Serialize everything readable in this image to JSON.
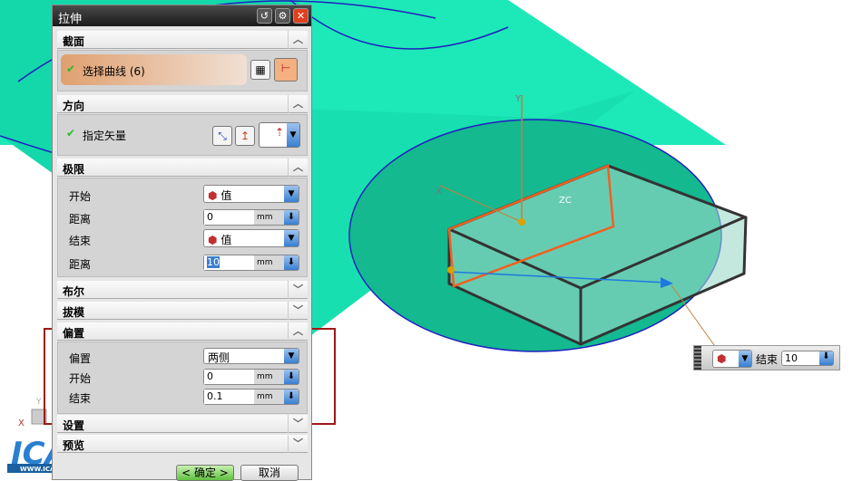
{
  "dialog": {
    "title": "拉伸",
    "title_buttons": [
      "reset",
      "settings",
      "close"
    ]
  },
  "sections": {
    "section": {
      "header": "截面",
      "select_curve": "选择曲线 (6)"
    },
    "direction": {
      "header": "方向",
      "specify_vector": "指定矢量"
    },
    "limits": {
      "header": "极限",
      "start_label": "开始",
      "start_option": "值",
      "distance1_label": "距离",
      "distance1_value": "0",
      "end_label": "结束",
      "end_option": "值",
      "distance2_label": "距离",
      "distance2_value": "10",
      "unit": "mm"
    },
    "boolean": {
      "header": "布尔"
    },
    "draft": {
      "header": "拔模"
    },
    "offset": {
      "header": "偏置",
      "offset_label": "偏置",
      "offset_option": "两侧",
      "start_label": "开始",
      "start_value": "0",
      "end_label": "结束",
      "end_value": "0.1",
      "unit": "mm"
    },
    "settings": {
      "header": "设置"
    },
    "preview": {
      "header": "预览"
    }
  },
  "buttons": {
    "ok": "< 确定 >",
    "cancel": "取消"
  },
  "floating": {
    "end_label": "结束",
    "end_value": "10"
  },
  "axes": {
    "x": "X",
    "y": "Y",
    "zc": "ZC",
    "yc": "YC"
  },
  "logo": {
    "text": "ICAX",
    "url": "WWW.ICAX.ORG"
  }
}
